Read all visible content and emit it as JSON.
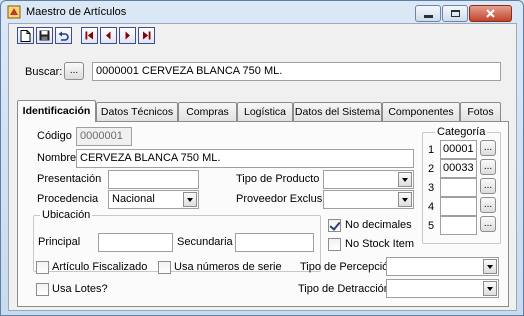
{
  "window": {
    "title": "Maestro de Artículos"
  },
  "search": {
    "label": "Buscar:",
    "button_label": "...",
    "value": "0000001  CERVEZA BLANCA 750 ML."
  },
  "tabs": [
    {
      "label": "Identificación"
    },
    {
      "label": "Datos Técnicos"
    },
    {
      "label": "Compras"
    },
    {
      "label": "Logística"
    },
    {
      "label": "Datos del Sistema"
    },
    {
      "label": "Componentes"
    },
    {
      "label": "Fotos"
    }
  ],
  "form": {
    "codigo_label": "Código",
    "codigo_value": "0000001",
    "nombre_label": "Nombre",
    "nombre_value": "CERVEZA BLANCA 750 ML.",
    "presentacion_label": "Presentación",
    "presentacion_value": "",
    "procedencia_label": "Procedencia",
    "procedencia_value": "Nacional",
    "tipo_producto_label": "Tipo de Producto",
    "tipo_producto_value": "",
    "proveedor_label": "Proveedor Exclusivo",
    "proveedor_value": "",
    "ubicacion_label": "Ubicación",
    "principal_label": "Principal",
    "principal_value": "",
    "secundaria_label": "Secundaria",
    "secundaria_value": "",
    "no_decimales_label": "No decimales",
    "no_decimales_checked": true,
    "no_stock_label": "No Stock Item",
    "no_stock_checked": false,
    "articulo_fiscalizado_label": "Artículo Fiscalizado",
    "usa_series_label": "Usa números de serie",
    "usa_lotes_label": "Usa Lotes?",
    "tipo_percepcion_label": "Tipo de Percepción",
    "tipo_percepcion_value": "",
    "tipo_detraccion_label": "Tipo de Detracción",
    "tipo_detraccion_value": ""
  },
  "categoria": {
    "title": "Categoría",
    "button_label": "...",
    "rows": [
      {
        "num": "1",
        "value": "00001"
      },
      {
        "num": "2",
        "value": "00033"
      },
      {
        "num": "3",
        "value": ""
      },
      {
        "num": "4",
        "value": ""
      },
      {
        "num": "5",
        "value": ""
      }
    ]
  },
  "icons": {
    "toolbar": [
      "new-icon",
      "save-icon",
      "undo-icon",
      "first-record-icon",
      "prev-record-icon",
      "next-record-icon",
      "last-record-icon"
    ],
    "accent": "#1f3d8c"
  }
}
